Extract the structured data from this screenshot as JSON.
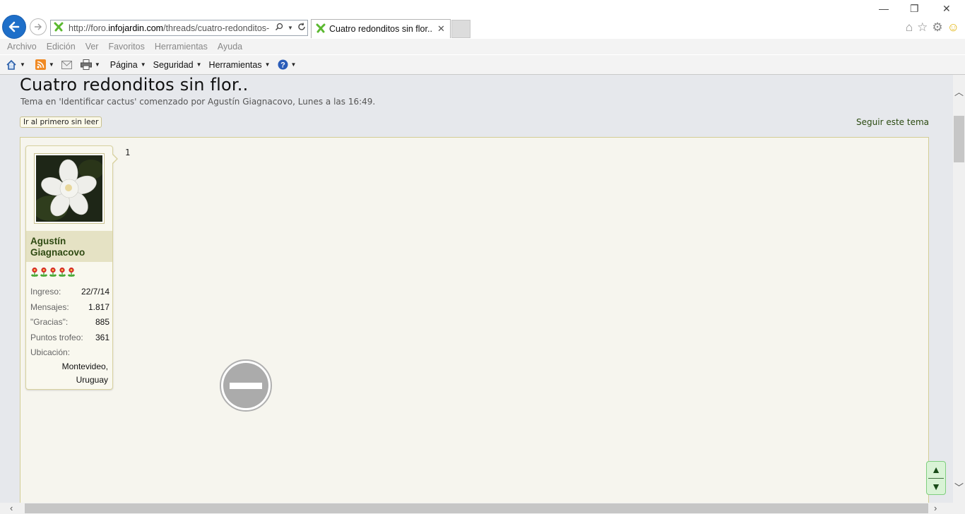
{
  "browser": {
    "url_prefix": "http://foro.",
    "url_domain": "infojardin.com",
    "url_path": "/threads/cuatro-redonditos-",
    "tab_title": "Cuatro redonditos sin flor..",
    "menu": [
      "Archivo",
      "Edición",
      "Ver",
      "Favoritos",
      "Herramientas",
      "Ayuda"
    ],
    "commands": {
      "page": "Página",
      "security": "Seguridad",
      "tools": "Herramientas"
    }
  },
  "thread": {
    "title": "Cuatro redonditos sin flor..",
    "description": "Tema en 'Identificar cactus' comenzado por Agustín Giagnacovo, Lunes a las 16:49.",
    "unread_button": "Ir al primero sin leer",
    "follow_link": "Seguir este tema"
  },
  "post": {
    "number": "1",
    "author": {
      "name_line1": "Agustín",
      "name_line2": "Giagnacovo",
      "rating_icons": 5,
      "stats": [
        {
          "label": "Ingreso:",
          "value": "22/7/14"
        },
        {
          "label": "Mensajes:",
          "value": "1.817"
        },
        {
          "label": "\"Gracias\":",
          "value": "885"
        },
        {
          "label": "Puntos trofeo:",
          "value": "361"
        }
      ],
      "location_label": "Ubicación:",
      "location_line1": "Montevideo,",
      "location_line2": "Uruguay"
    }
  },
  "scroll_controls": {
    "up": "▲",
    "down": "▼"
  }
}
